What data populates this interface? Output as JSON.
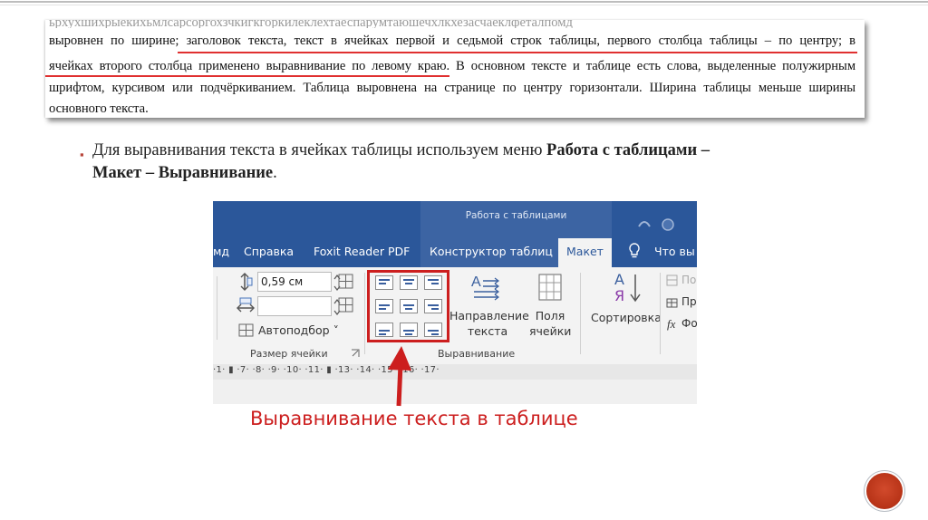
{
  "document": {
    "line1": "выровнен по ширине; заголовок текста, текст в ячейках первой и седьмой строк таблицы, первого столбца таблицы – по центру; в",
    "line2": "ячейках второго столбца применено выравнивание по левому краю. В основном тексте и таблице есть слова, выделенные полужирным",
    "line3": "шрифтом, курсивом или подчёркиванием. Таблица выровнена на странице по центру горизонтали. Ширина таблицы меньше ширины",
    "line4": "основного текста."
  },
  "bullet": {
    "marker": "▪",
    "text_plain": "Для выравнивания текста в ячейках таблицы используем меню ",
    "text_bold1": "Работа с таблицами –",
    "text_bold2": "Макет – Выравнивание",
    "text_end": "."
  },
  "ribbon": {
    "context_title": "Работа с таблицами",
    "tabs": [
      "мд",
      "Справка",
      "Foxit Reader PDF",
      "Конструктор таблиц",
      "Макет",
      "Что вы"
    ],
    "active_tab": "Макет",
    "height_value": "0,59 см",
    "width_value": "",
    "autofit_label": "Автоподбор",
    "autofit_chevron": "˅",
    "group_cell_size": "Размер ячейки",
    "group_alignment": "Выравнивание",
    "text_direction_line1": "Направление",
    "text_direction_line2": "текста",
    "margins_line1": "Поля",
    "margins_line2": "ячейки",
    "sort_label": "Сортировка",
    "sort_letters": [
      "А",
      "Я"
    ],
    "right_items": [
      "По",
      "Пр",
      "Фо"
    ],
    "fx_label": "fx",
    "ruler_text": "·1· ▮ ·7· ·8· ·9· ·10· ·11· ▮ ·13· ·14· ·15· ·16· ·17·"
  },
  "caption": "Выравнивание текста в таблице",
  "colors": {
    "ribbon_blue": "#2b579a",
    "highlight_red": "#cc1e1e",
    "underline_red": "#e03030",
    "nav_button": "#b73317"
  },
  "icons": [
    "height-icon",
    "width-icon",
    "distribute-rows-icon",
    "distribute-columns-icon",
    "autofit-icon",
    "dialog-launcher-icon",
    "text-direction-icon",
    "cell-margins-icon",
    "sort-icon",
    "lightbulb-icon",
    "formula-icon",
    "arrow-icon",
    "next-slide-button"
  ]
}
